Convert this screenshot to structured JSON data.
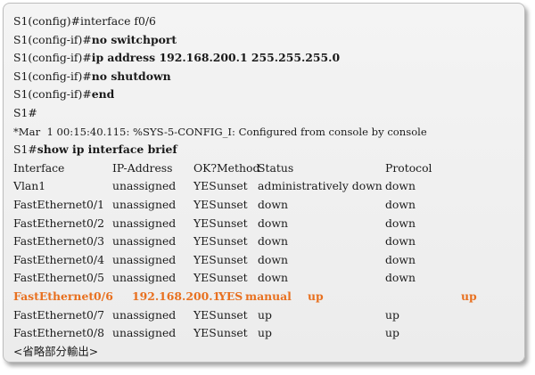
{
  "config_lines": [
    {
      "prompt": "S1(config)#",
      "command": "interface f0/6",
      "bold": false
    },
    {
      "prompt": "S1(config-if)#",
      "command": "no switchport",
      "bold": true
    },
    {
      "prompt": "S1(config-if)#",
      "command": "ip address 192.168.200.1 255.255.255.0",
      "bold": true
    },
    {
      "prompt": "S1(config-if)#",
      "command": "no shutdown",
      "bold": true
    },
    {
      "prompt": "S1(config-if)#",
      "command": "end",
      "bold": true
    },
    {
      "prompt": "S1#",
      "command": "",
      "bold": false
    }
  ],
  "log_message": "*Mar  1 00:15:40.115: %SYS-5-CONFIG_I: Configured from console by console",
  "show_command": {
    "prompt": "S1#",
    "command": "show ip interface brief"
  },
  "table": {
    "headers": {
      "interface": "Interface",
      "ip": "IP-Address",
      "ok": "OK?",
      "method": "Method",
      "status": "Status",
      "protocol": "Protocol"
    },
    "rows": [
      {
        "interface": "Vlan1",
        "ip": "unassigned",
        "ok": "YES",
        "method": "unset",
        "status": "administratively down",
        "protocol": "down",
        "highlight": false
      },
      {
        "interface": "FastEthernet0/1",
        "ip": "unassigned",
        "ok": "YES",
        "method": "unset",
        "status": "down",
        "protocol": "down",
        "highlight": false
      },
      {
        "interface": "FastEthernet0/2",
        "ip": "unassigned",
        "ok": "YES",
        "method": "unset",
        "status": "down",
        "protocol": "down",
        "highlight": false
      },
      {
        "interface": "FastEthernet0/3",
        "ip": "unassigned",
        "ok": "YES",
        "method": "unset",
        "status": "down",
        "protocol": "down",
        "highlight": false
      },
      {
        "interface": "FastEthernet0/4",
        "ip": "unassigned",
        "ok": "YES",
        "method": "unset",
        "status": "down",
        "protocol": "down",
        "highlight": false
      },
      {
        "interface": "FastEthernet0/5",
        "ip": "unassigned",
        "ok": "YES",
        "method": "unset",
        "status": "down",
        "protocol": "down",
        "highlight": false
      },
      {
        "interface": "FastEthernet0/6",
        "ip": "192.168.200.1",
        "ok": "YES",
        "method": "manual",
        "status": "up",
        "protocol": "up",
        "highlight": true
      },
      {
        "interface": "FastEthernet0/7",
        "ip": "unassigned",
        "ok": "YES",
        "method": "unset",
        "status": "up",
        "protocol": "up",
        "highlight": false
      },
      {
        "interface": "FastEthernet0/8",
        "ip": "unassigned",
        "ok": "YES",
        "method": "unset",
        "status": "up",
        "protocol": "up",
        "highlight": false
      }
    ]
  },
  "omitted_note": "<省略部分輸出>",
  "colors": {
    "highlight": "#e8701f",
    "text": "#1a1a1a",
    "background": "#f4f4f4"
  }
}
